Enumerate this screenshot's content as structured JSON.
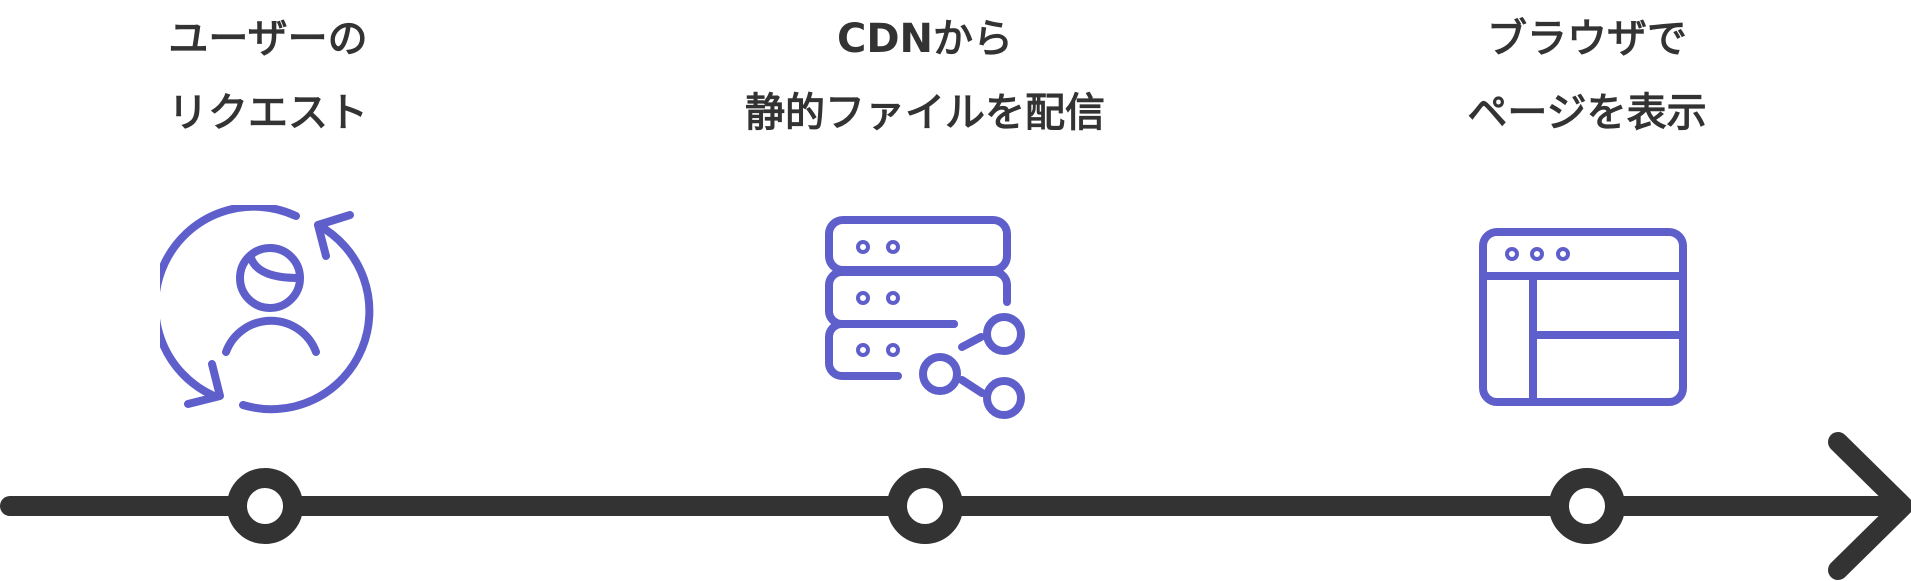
{
  "steps": [
    {
      "line1": "ユーザーの",
      "line2": "リクエスト",
      "icon": "user-refresh-icon"
    },
    {
      "line1": "CDNから",
      "line2": "静的ファイルを配信",
      "icon": "server-network-icon"
    },
    {
      "line1": "ブラウザで",
      "line2": "ページを表示",
      "icon": "browser-window-icon"
    }
  ],
  "colors": {
    "icon": "#5f5fcc",
    "text": "#333333",
    "timeline": "#333333"
  }
}
